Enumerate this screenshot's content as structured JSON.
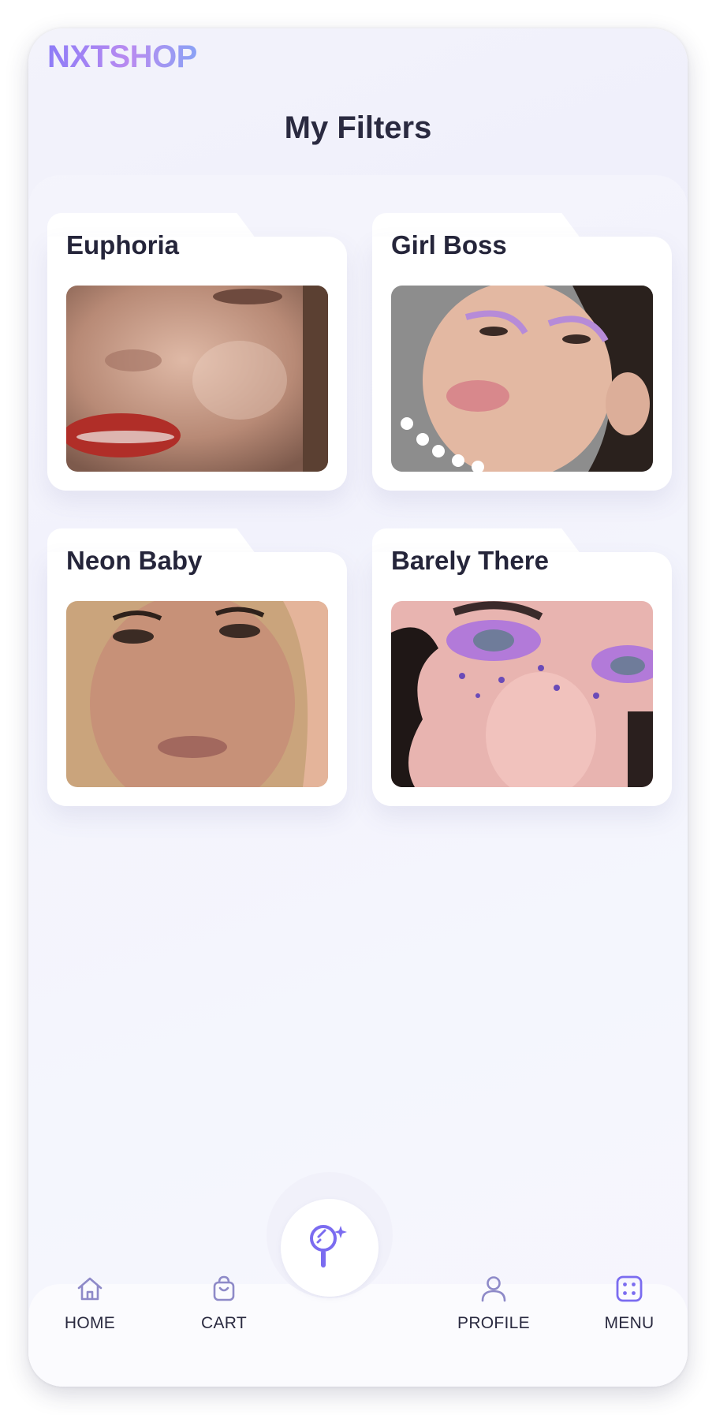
{
  "app": {
    "logo": "NXTSHOP"
  },
  "page": {
    "title": "My Filters"
  },
  "filters": [
    {
      "name": "Euphoria"
    },
    {
      "name": "Girl Boss"
    },
    {
      "name": "Neon Baby"
    },
    {
      "name": "Barely There"
    }
  ],
  "nav": {
    "items": [
      {
        "label": "HOME",
        "icon": "home-icon"
      },
      {
        "label": "CART",
        "icon": "shopping-bag-icon"
      },
      {
        "label": "PROFILE",
        "icon": "user-icon"
      },
      {
        "label": "MENU",
        "icon": "grid-menu-icon"
      }
    ],
    "center_icon": "hand-mirror-sparkle-icon"
  },
  "colors": {
    "accent": "#7b6cf0",
    "icon_muted": "#8e8ac8",
    "title": "#2a2a40"
  }
}
